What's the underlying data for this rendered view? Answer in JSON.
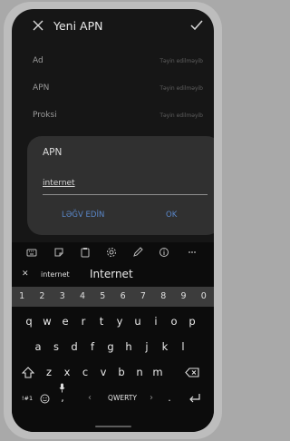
{
  "appbar": {
    "title": "Yeni APN"
  },
  "settings_rows": [
    {
      "label": "Ad",
      "value": "Təyin edilməyib"
    },
    {
      "label": "APN",
      "value": "Təyin edilməyib"
    },
    {
      "label": "Proksi",
      "value": "Təyin edilməyib"
    }
  ],
  "dialog": {
    "title": "APN",
    "input_value": "internet",
    "cancel_label": "LƏĞV EDİN",
    "ok_label": "OK"
  },
  "keyboard": {
    "toolbar_icons": [
      "keyboard-icon",
      "sticker-icon",
      "clipboard-icon",
      "settings-icon",
      "edit-icon",
      "info-icon",
      "more-icon"
    ],
    "suggestion_close": "✕",
    "suggestion_small": "internet",
    "suggestion_large": "Internet",
    "number_row": [
      "1",
      "2",
      "3",
      "4",
      "5",
      "6",
      "7",
      "8",
      "9",
      "0"
    ],
    "row1": [
      "q",
      "w",
      "e",
      "r",
      "t",
      "y",
      "u",
      "i",
      "o",
      "p"
    ],
    "row2": [
      "a",
      "s",
      "d",
      "f",
      "g",
      "h",
      "j",
      "k",
      "l"
    ],
    "row3": [
      "z",
      "x",
      "c",
      "v",
      "b",
      "n",
      "m"
    ],
    "bottom": {
      "sym": "!#1",
      "space": "QWERTY",
      "comma": ",",
      "period": "."
    }
  },
  "colors": {
    "accent": "#5a87c9",
    "background": "#161616",
    "dialog": "#303030"
  }
}
